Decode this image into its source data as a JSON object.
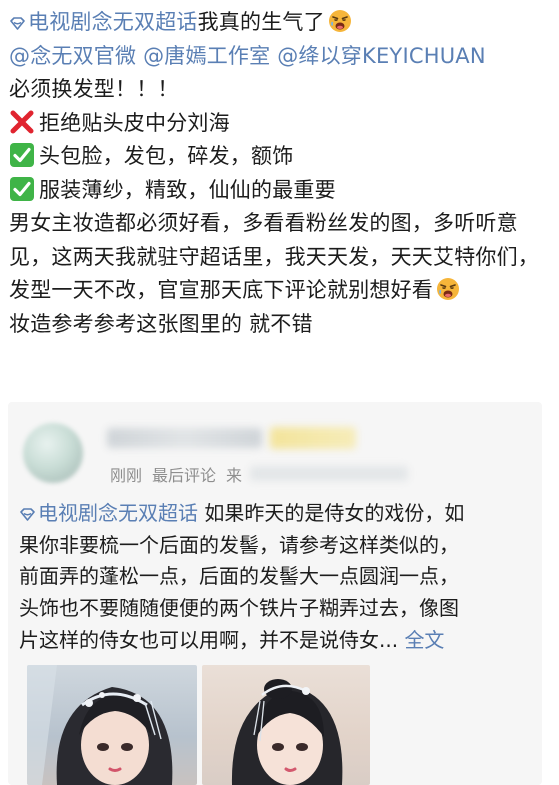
{
  "post": {
    "topic": "电视剧念无双超话",
    "headline_rest": "我真的生气了",
    "mentions": [
      "@念无双官微",
      "@唐嫣工作室",
      "@绛以穿KEYICHUAN"
    ],
    "line_must": "必须换发型！！！",
    "reject_item": "拒绝贴头皮中分刘海",
    "check_item_1": "头包脸，发包，碎发，额饰",
    "check_item_2": "服装薄纱，精致，仙仙的最重要",
    "paragraph": "男女主妆造都必须好看，多看看粉丝发的图，多听听意见，这两天我就驻守超话里，我天天发，天天艾特你们，发型一天不改，官宣那天底下评论就别想好看",
    "line_last": "妆造参考参考这张图里的 就不错",
    "emoji": "angry-face",
    "reject_icon": "red-x-icon",
    "check_icon": "green-check-icon"
  },
  "comment": {
    "time": "刚刚",
    "label": "最后评论",
    "from_prefix": "来",
    "topic": "电视剧念无双超话",
    "lines": [
      "如果昨天的是侍女的戏份，如",
      "果你非要梳一个后面的发髻，请参考这样类似的，",
      "前面弄的蓬松一点，后面的发髻大一点圆润一点，",
      "头饰也不要随随便便的两个铁片子糊弄过去，像图",
      "片这样的侍女也可以用啊，并不是说侍女..."
    ],
    "more": "全文"
  },
  "colors": {
    "link": "#5a7fb4",
    "text": "#1c1c1c",
    "meta": "#8e8e8e",
    "card_bg": "#f6f6f6",
    "reject": "#e0242f",
    "check": "#3fb447"
  }
}
